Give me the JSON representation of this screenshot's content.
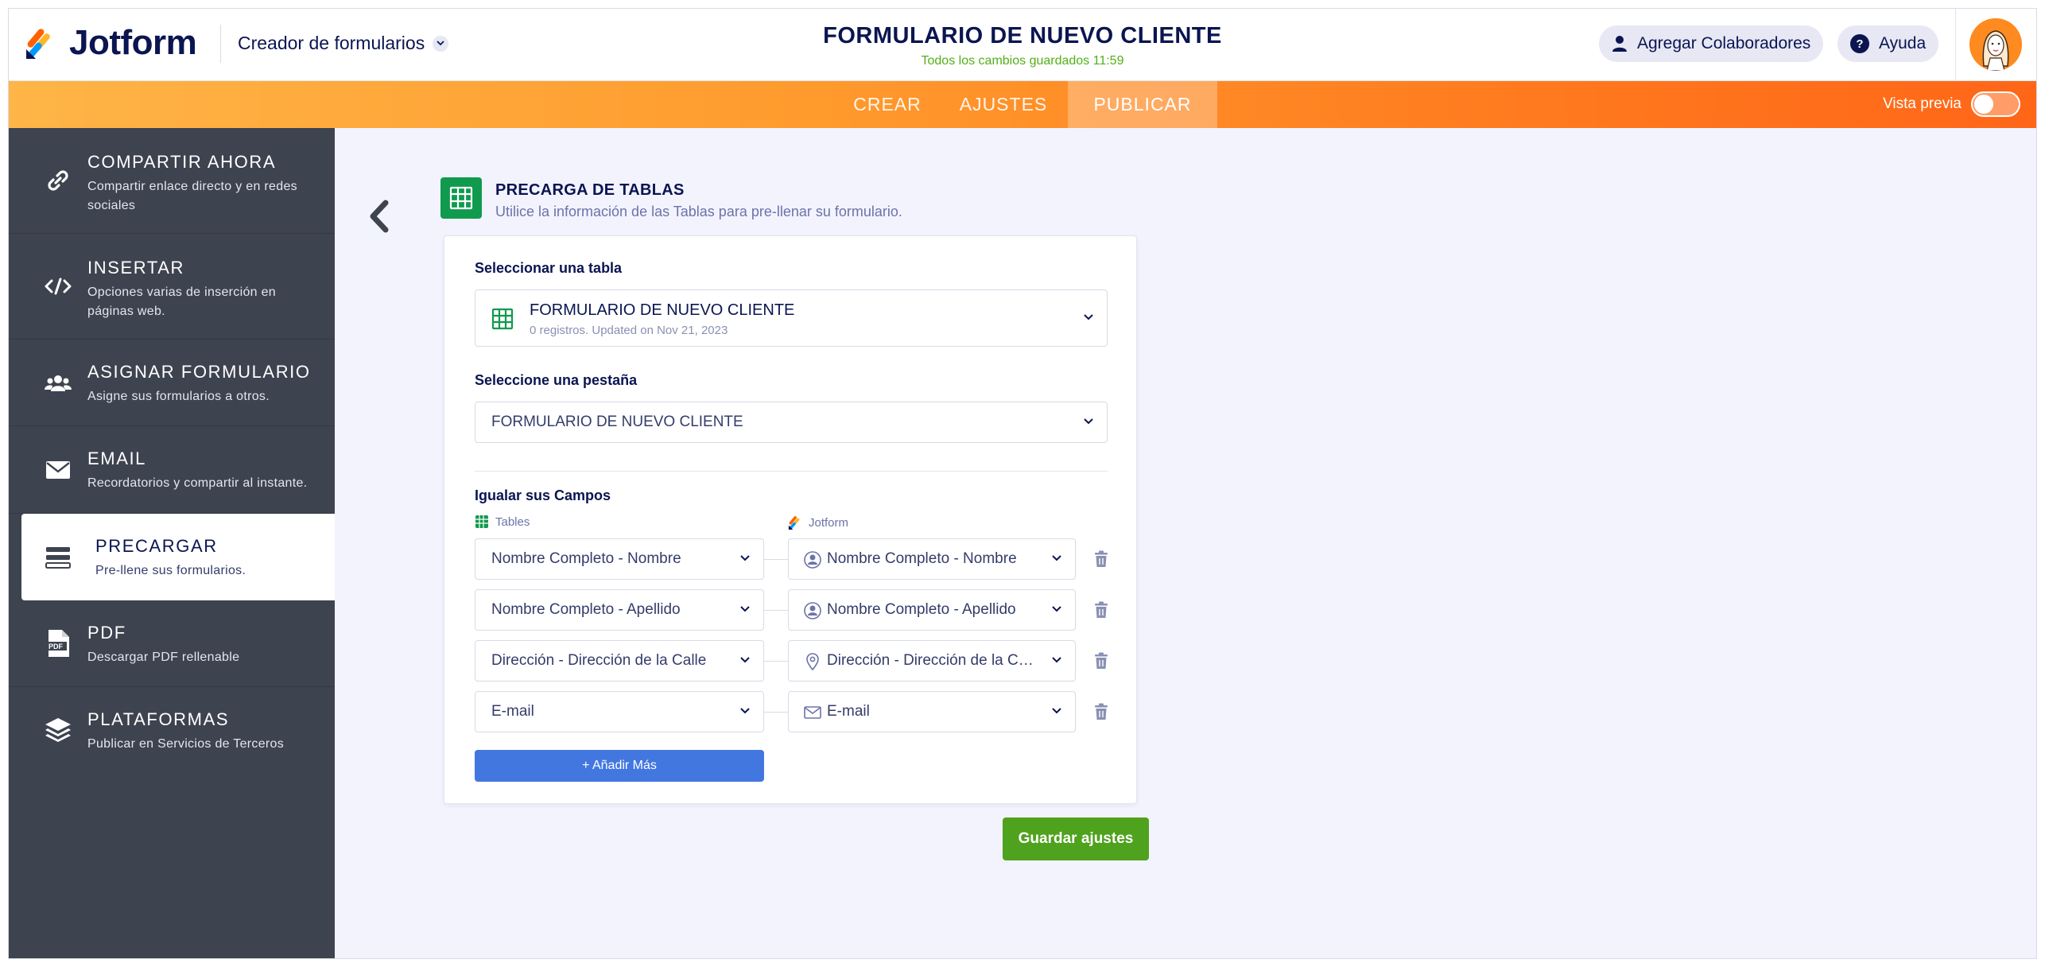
{
  "header": {
    "logo_text": "Jotform",
    "builder_menu": "Creador de formularios",
    "form_title": "FORMULARIO DE NUEVO CLIENTE",
    "save_status": "Todos los cambios guardados 11:59",
    "collab_label": "Agregar Colaboradores",
    "help_label": "Ayuda"
  },
  "nav": {
    "tabs": [
      {
        "label": "CREAR"
      },
      {
        "label": "AJUSTES"
      },
      {
        "label": "PUBLICAR",
        "active": true
      }
    ],
    "preview_label": "Vista previa",
    "preview_on": false
  },
  "sidebar": {
    "items": [
      {
        "title": "COMPARTIR AHORA",
        "desc": "Compartir enlace directo y en redes sociales",
        "icon": "link-icon"
      },
      {
        "title": "INSERTAR",
        "desc": "Opciones varias de inserción en páginas web.",
        "icon": "code-icon"
      },
      {
        "title": "ASIGNAR FORMULARIO",
        "desc": "Asigne sus formularios a otros.",
        "icon": "users-icon"
      },
      {
        "title": "EMAIL",
        "desc": "Recordatorios y compartir al instante.",
        "icon": "envelope-icon"
      },
      {
        "title": "PRECARGAR",
        "desc": "Pre-llene sus formularios.",
        "icon": "prefill-icon",
        "active": true
      },
      {
        "title": "PDF",
        "desc": "Descargar PDF rellenable",
        "icon": "pdf-icon"
      },
      {
        "title": "PLATAFORMAS",
        "desc": "Publicar en Servicios de Terceros",
        "icon": "layers-icon"
      }
    ]
  },
  "main": {
    "title": "PRECARGA DE TABLAS",
    "subtitle": "Utilice la información de las Tablas para pre-llenar su formulario.",
    "table_select": {
      "label": "Seleccionar una tabla",
      "value": "FORMULARIO DE NUEVO CLIENTE",
      "meta": "0 registros. Updated on Nov 21, 2023"
    },
    "tab_select": {
      "label": "Seleccione una pestaña",
      "value": "FORMULARIO DE NUEVO CLIENTE"
    },
    "mapping": {
      "label": "Igualar sus Campos",
      "left_header": "Tables",
      "right_header": "Jotform",
      "rows": [
        {
          "table_field": "Nombre Completo - Nombre",
          "form_field": "Nombre Completo - Nombre",
          "icon": "user-icon"
        },
        {
          "table_field": "Nombre Completo - Apellido",
          "form_field": "Nombre Completo - Apellido",
          "icon": "user-icon"
        },
        {
          "table_field": "Dirección - Dirección de la Calle",
          "form_field": "Dirección - Dirección de la Calle",
          "icon": "location-pin-icon"
        },
        {
          "table_field": "E-mail",
          "form_field": "E-mail",
          "icon": "envelope-icon"
        }
      ],
      "add_label": "+ Añadir Más"
    },
    "save_label": "Guardar ajustes"
  },
  "colors": {
    "accent_orange": "#ff7a1e",
    "sidebar_bg": "#3d434f",
    "primary_blue": "#4277e0",
    "save_green": "#4fa21d",
    "sheet_green": "#109a4e"
  }
}
